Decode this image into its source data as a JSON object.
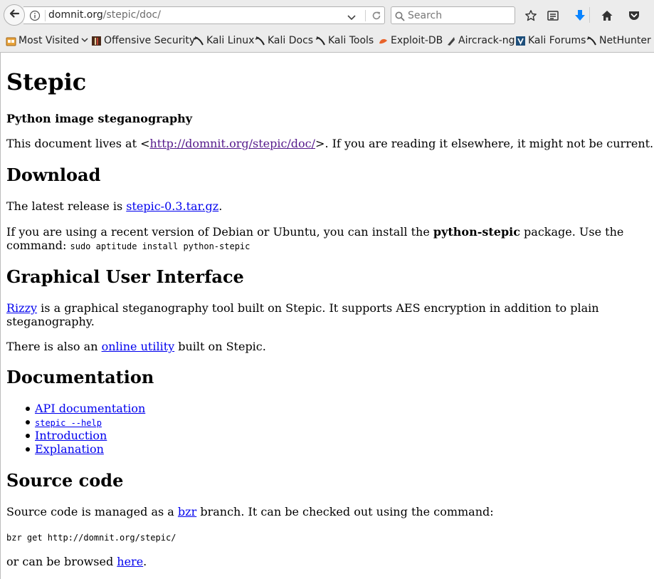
{
  "browser": {
    "url_host": "domnit.org",
    "url_path": "/stepic/doc/",
    "search_placeholder": "Search"
  },
  "bookmarks": [
    {
      "label": "Most Visited",
      "icon": "most-visited-icon"
    },
    {
      "label": "Offensive Security",
      "icon": "offsec-icon"
    },
    {
      "label": "Kali Linux",
      "icon": "kali-icon"
    },
    {
      "label": "Kali Docs",
      "icon": "kali-icon"
    },
    {
      "label": "Kali Tools",
      "icon": "kali-icon"
    },
    {
      "label": "Exploit-DB",
      "icon": "exploitdb-icon"
    },
    {
      "label": "Aircrack-ng",
      "icon": "aircrack-icon"
    },
    {
      "label": "Kali Forums",
      "icon": "kali-forums-icon"
    },
    {
      "label": "NetHunter",
      "icon": "kali-icon"
    }
  ],
  "page": {
    "title": "Stepic",
    "subtitle": "Python image steganography",
    "intro_before": "This document lives at <",
    "intro_link": "http://domnit.org/stepic/doc/",
    "intro_after": ">. If you are reading it elsewhere, it might not be current.",
    "download": {
      "heading": "Download",
      "latest_before": "The latest release is ",
      "latest_link": "stepic-0.3.tar.gz",
      "latest_after": ".",
      "install_before": "If you are using a recent version of Debian or Ubuntu, you can install the ",
      "install_pkg": "python-stepic",
      "install_after": " package. Use the",
      "install_line2": "command: ",
      "install_cmd": "sudo aptitude install python-stepic"
    },
    "gui": {
      "heading": "Graphical User Interface",
      "rizzy_link": "Rizzy",
      "rizzy_line1": " is a graphical steganography tool built on Stepic. It supports AES encryption in addition to plain",
      "rizzy_line2": "steganography.",
      "online_before": "There is also an ",
      "online_link": "online utility",
      "online_after": " built on Stepic."
    },
    "docs": {
      "heading": "Documentation",
      "items": [
        "API documentation",
        "stepic --help",
        "Introduction",
        "Explanation"
      ]
    },
    "source": {
      "heading": "Source code",
      "managed_before": "Source code is managed as a ",
      "managed_link": "bzr",
      "managed_after": " branch. It can be checked out using the command:",
      "checkout_cmd": "bzr get http://domnit.org/stepic/",
      "browse_before": "or can be browsed ",
      "browse_link": "here",
      "browse_after": "."
    }
  }
}
